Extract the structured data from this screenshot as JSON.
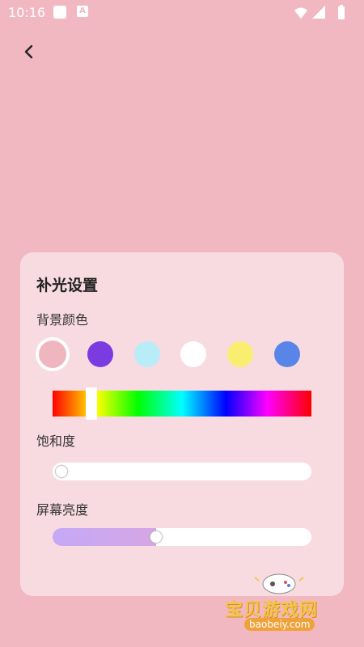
{
  "status_bar": {
    "time": "10:16",
    "a_icon": "A"
  },
  "header": {
    "back_icon": "chevron-left-icon"
  },
  "panel": {
    "title": "补光设置",
    "background_label": "背景颜色",
    "saturation_label": "饱和度",
    "brightness_label": "屏幕亮度",
    "swatches": [
      {
        "color": "#f0b6c0",
        "selected": true
      },
      {
        "color": "#7a3ce0",
        "selected": false
      },
      {
        "color": "#b8ecf7",
        "selected": false
      },
      {
        "color": "#ffffff",
        "selected": false
      },
      {
        "color": "#f9ee70",
        "selected": false
      },
      {
        "color": "#5a85e8",
        "selected": false
      }
    ],
    "hue_position": 0.15,
    "saturation_value": 0.0,
    "brightness_value": 0.4
  },
  "watermark": {
    "name": "宝贝游戏网",
    "url": "baobeiy.com"
  },
  "colors": {
    "page_bg": "#f1b8c2",
    "panel_bg": "#f8dbe1",
    "watermark_gold": "#f3c64a"
  }
}
